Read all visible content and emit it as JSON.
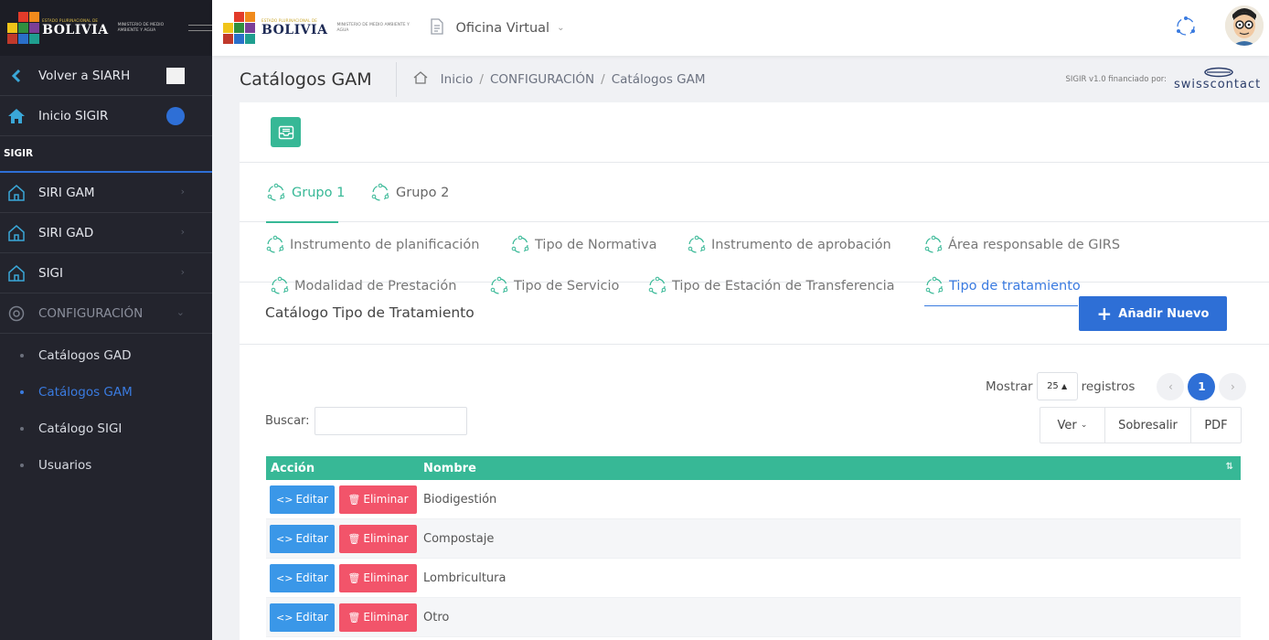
{
  "sidebar": {
    "brand": {
      "small": "ESTADO PLURINACIONAL DE",
      "name": "BOLIVIA",
      "ministry": "Ministerio de Medio Ambiente y Agua"
    },
    "back": "Volver a SIARH",
    "home": "Inicio SIGIR",
    "section": "SIGIR",
    "items": [
      {
        "label": "SIRI GAM"
      },
      {
        "label": "SIRI GAD"
      },
      {
        "label": "SIGI"
      }
    ],
    "config": "CONFIGURACIÓN",
    "submenu": [
      {
        "label": "Catálogos GAD"
      },
      {
        "label": "Catálogos GAM"
      },
      {
        "label": "Catálogo SIGI"
      },
      {
        "label": "Usuarios"
      }
    ]
  },
  "topbar": {
    "brand": {
      "small": "ESTADO PLURINACIONAL DE",
      "name": "BOLIVIA",
      "ministry": "Ministerio de Medio Ambiente y Agua"
    },
    "module": "Oficina Virtual"
  },
  "header": {
    "title": "Catálogos GAM",
    "breadcrumb": [
      "Inicio",
      "CONFIGURACIÓN",
      "Catálogos GAM"
    ],
    "funding": "SIGIR v1.0 financiado por:",
    "sponsor": "swisscontact"
  },
  "group_tabs": [
    "Grupo 1",
    "Grupo 2"
  ],
  "sub_tabs": [
    "Instrumento de planificación",
    "Tipo de Normativa",
    "Instrumento de aprobación",
    "Área responsable de GIRS",
    "Modalidad de Prestación",
    "Tipo de Servicio",
    "Tipo de Estación de Transferencia",
    "Tipo de tratamiento"
  ],
  "catalog_title": "Catálogo Tipo de Tratamiento",
  "add_button": "Añadir Nuevo",
  "table_controls": {
    "show": "Mostrar",
    "page_size": "25",
    "records": "registros",
    "current_page": "1",
    "search_label": "Buscar:",
    "search_value": "",
    "export": [
      "Ver",
      "Sobresalir",
      "PDF"
    ]
  },
  "table": {
    "headers": [
      "Acción",
      "Nombre"
    ],
    "edit_label": "Editar",
    "delete_label": "Eliminar",
    "rows": [
      "Biodigestión",
      "Compostaje",
      "Lombricultura",
      "Otro"
    ]
  },
  "colors": {
    "accent_green": "#37b896",
    "primary_blue": "#2e6fd6",
    "danger": "#f2546a",
    "info": "#3a97e8",
    "sidebar_bg": "#23242d"
  }
}
